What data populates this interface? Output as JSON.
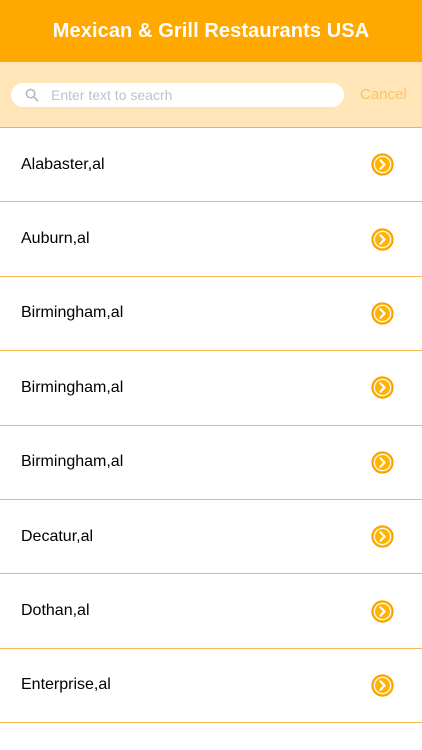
{
  "header": {
    "title": "Mexican & Grill Restaurants USA"
  },
  "search": {
    "placeholder": "Enter text to seacrh",
    "value": "",
    "cancel_label": "Cancel"
  },
  "list": {
    "items": [
      {
        "label": "Alabaster,al"
      },
      {
        "label": "Auburn,al"
      },
      {
        "label": "Birmingham,al"
      },
      {
        "label": "Birmingham,al"
      },
      {
        "label": "Birmingham,al"
      },
      {
        "label": "Decatur,al"
      },
      {
        "label": "Dothan,al"
      },
      {
        "label": "Enterprise,al"
      }
    ]
  },
  "colors": {
    "accent": "#ffa800",
    "search_bar_bg": "#ffe5b7",
    "divider": "#f6b653",
    "cancel_text": "#f9c46c"
  },
  "icons": {
    "search": "search-icon",
    "row_disclosure": "chevron-right-circle-icon"
  }
}
